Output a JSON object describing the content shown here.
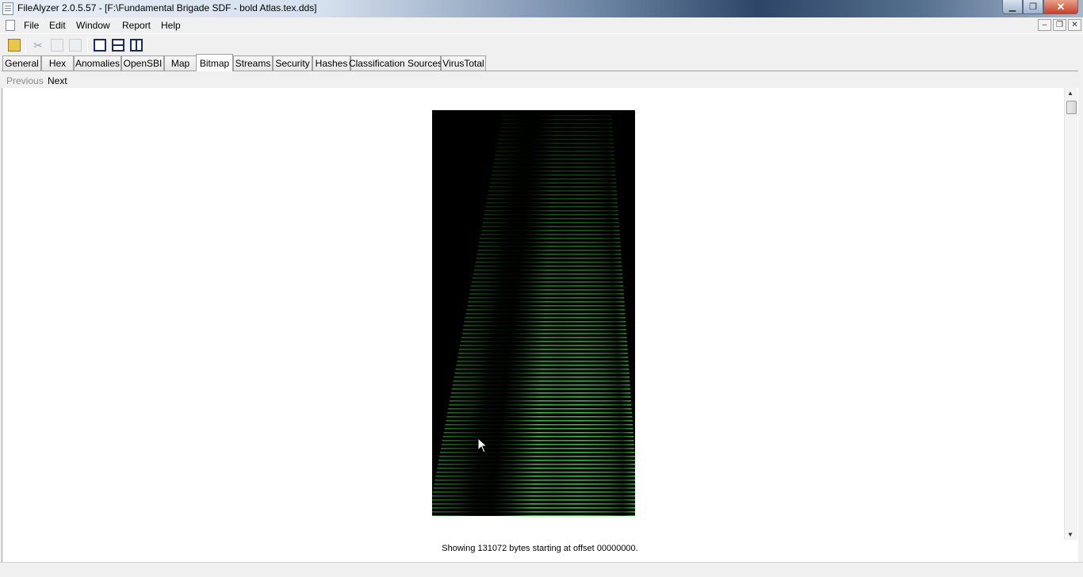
{
  "window": {
    "title": "FileAlyzer 2.0.5.57 - [F:\\Fundamental Brigade SDF - bold Atlas.tex.dds]",
    "minimize_glyph": "▁",
    "maximize_glyph": "❐",
    "close_glyph": "✕"
  },
  "menu": {
    "items": [
      "File",
      "Edit",
      "Window",
      "Report",
      "Help"
    ]
  },
  "mdi": {
    "minimize_glyph": "–",
    "restore_glyph": "❐",
    "close_glyph": "✕"
  },
  "toolbar": {
    "icons": [
      "open-icon",
      "cut-icon",
      "copy-icon",
      "paste-icon",
      "cascade-icon",
      "tile-horizontal-icon",
      "tile-vertical-icon"
    ],
    "cut_glyph": "✂"
  },
  "tabs": {
    "items": [
      "General",
      "Hex",
      "Anomalies",
      "OpenSBI",
      "Map",
      "Bitmap",
      "Streams",
      "Security",
      "Hashes",
      "Classification Sources",
      "VirusTotal"
    ],
    "active": "Bitmap"
  },
  "nav": {
    "previous_label": "Previous",
    "next_label": "Next"
  },
  "bitmap": {
    "color": "#39d13a",
    "background": "#000000"
  },
  "scroll": {
    "up_glyph": "▲",
    "down_glyph": "▼"
  },
  "status": {
    "text": "Showing 131072 bytes starting at offset 00000000."
  }
}
